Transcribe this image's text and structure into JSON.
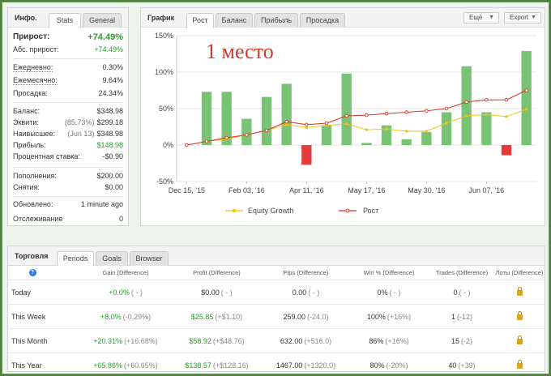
{
  "stats_panel": {
    "title": "Инфо.",
    "tabs": [
      "Stats",
      "General"
    ],
    "active_tab": "Stats",
    "gain_label": "Прирост:",
    "gain_value": "+74.49%",
    "abs_gain_label": "Абс. прирост:",
    "abs_gain_value": "+74.49%",
    "daily_label": "Ежедневно:",
    "daily_value": "0.30%",
    "monthly_label": "Ежемесячно:",
    "monthly_value": "9.64%",
    "drawdown_label": "Просадка:",
    "drawdown_value": "24.34%",
    "balance_label": "Баланс:",
    "balance_value": "$348.98",
    "equity_label": "Эквити:",
    "equity_extra": "(85.73%)",
    "equity_value": "$299.18",
    "highest_label": "Наивысшее:",
    "highest_extra": "(Jun 13)",
    "highest_value": "$348.98",
    "profit_label": "Прибыль:",
    "profit_value": "$148.98",
    "interest_label": "Процентная ставка:",
    "interest_value": "-$0.90",
    "deposits_label": "Пополнения:",
    "deposits_value": "$200.00",
    "withdrawals_label": "Снятия:",
    "withdrawals_value": "$0.00",
    "updated_label": "Обновлено:",
    "updated_value": "1 minute ago",
    "tracking_label": "Отслеживание",
    "tracking_value": "0"
  },
  "chart_panel": {
    "title": "График",
    "tabs": [
      "Рост",
      "Баланс",
      "Прибыль",
      "Просадка"
    ],
    "active_tab": "Рост",
    "more_button": "Ещё",
    "export_button": "Export",
    "overlay_text": "1 место"
  },
  "chart_data": {
    "type": "bar",
    "ylim": [
      -50,
      150
    ],
    "yticks": [
      "150%",
      "100%",
      "50%",
      "0%",
      "-50%"
    ],
    "ytick_values": [
      150,
      100,
      50,
      0,
      -50
    ],
    "xticks": [
      "Dec 15, '15",
      "Feb 03, '16",
      "Apr 11, '16",
      "May 17, '16",
      "May 30, '16",
      "Jun 07, '16"
    ],
    "xtick_positions": [
      0,
      3,
      6,
      9,
      12,
      15
    ],
    "bars": [
      0,
      73,
      73,
      36,
      66,
      84,
      -27,
      27,
      98,
      3,
      27,
      8,
      18,
      45,
      108,
      45,
      -14,
      129
    ],
    "series": [
      {
        "name": "Equity Growth",
        "color": "#f0c419",
        "values": [
          0,
          5,
          8,
          14,
          20,
          28,
          24,
          27,
          29,
          21,
          22,
          19,
          19,
          30,
          40,
          42,
          39,
          49
        ]
      },
      {
        "name": "Рост",
        "color": "#d9322c",
        "values": [
          0,
          5,
          10,
          14,
          20,
          32,
          28,
          30,
          40,
          41,
          43,
          45,
          47,
          50,
          59,
          62,
          62,
          75
        ]
      }
    ],
    "bar_positive_color": "#79c474",
    "bar_negative_color": "#e63b3b"
  },
  "trade_panel": {
    "title": "Торговля",
    "tabs": [
      "Periods",
      "Goals",
      "Browser"
    ],
    "active_tab": "Periods",
    "help_icon": "?",
    "headers": [
      "Gain (Difference)",
      "Profit (Difference)",
      "Pips (Difference)",
      "Win % (Difference)",
      "Trades (Difference)",
      "Лоты (Difference)"
    ],
    "rows": [
      {
        "period": "Today",
        "gain": "+0.0%",
        "gain_diff": "( - )",
        "profit": "$0.00",
        "profit_diff": "( - )",
        "pips": "0.00",
        "pips_diff": "( - )",
        "win": "0%",
        "win_diff": "( - )",
        "trades": "0",
        "trades_diff": "( - )"
      },
      {
        "period": "This Week",
        "gain": "+8.0%",
        "gain_diff": "(-0.29%)",
        "profit": "$25.85",
        "profit_diff": "(+$1.10)",
        "pips": "259.00",
        "pips_diff": "(-24.0)",
        "win": "100%",
        "win_diff": "(+16%)",
        "trades": "1",
        "trades_diff": "(-12)"
      },
      {
        "period": "This Month",
        "gain": "+20.31%",
        "gain_diff": "(+16.68%)",
        "profit": "$58.92",
        "profit_diff": "(+$48.76)",
        "pips": "632.00",
        "pips_diff": "(+516.0)",
        "win": "86%",
        "win_diff": "(+16%)",
        "trades": "15",
        "trades_diff": "(-2)"
      },
      {
        "period": "This Year",
        "gain": "+65.86%",
        "gain_diff": "(+60.65%)",
        "profit": "$138.57",
        "profit_diff": "(+$128.16)",
        "pips": "1467.00",
        "pips_diff": "(+1320.0)",
        "win": "80%",
        "win_diff": "(-20%)",
        "trades": "40",
        "trades_diff": "(+39)"
      }
    ]
  }
}
